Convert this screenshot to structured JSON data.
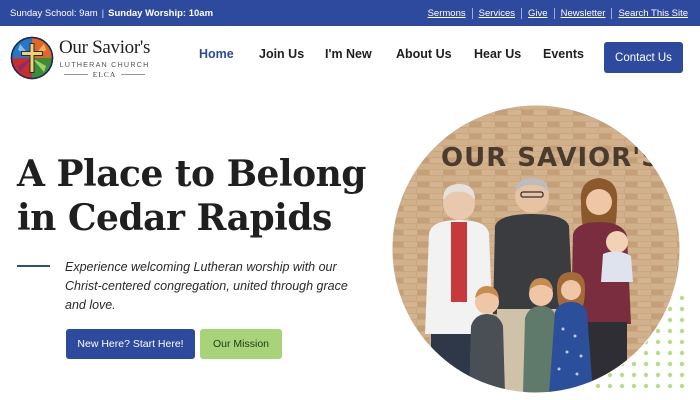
{
  "topbar": {
    "sunday_school": "Sunday School: 9am",
    "divider": "|",
    "sunday_worship": "Sunday Worship: 10am",
    "links": [
      "Sermons",
      "Services",
      "Give",
      "Newsletter",
      "Search This Site"
    ]
  },
  "logo": {
    "name": "Our Savior's",
    "subtitle": "LUTHERAN CHURCH",
    "affiliation": "ELCA",
    "icon": "stained-glass-cross-icon"
  },
  "nav": {
    "items": [
      {
        "label": "Home",
        "active": true
      },
      {
        "label": "Join Us",
        "active": false
      },
      {
        "label": "I'm New",
        "active": false
      },
      {
        "label": "About Us",
        "active": false
      },
      {
        "label": "Hear Us",
        "active": false
      },
      {
        "label": "Events",
        "active": false
      }
    ],
    "contact_label": "Contact Us"
  },
  "hero": {
    "title_line1": "A Place to Belong",
    "title_line2": "in Cedar Rapids",
    "description": "Experience welcoming Lutheran worship with our Christ-centered congregation, united through grace and love.",
    "primary_button": "New Here? Start Here!",
    "secondary_button": "Our Mission"
  },
  "photo": {
    "sign_text": "OUR SAVIOR'S"
  },
  "colors": {
    "brand_blue": "#2e4a9e",
    "accent_green": "#a9d37a",
    "dot_green": "#b7dc8a"
  }
}
